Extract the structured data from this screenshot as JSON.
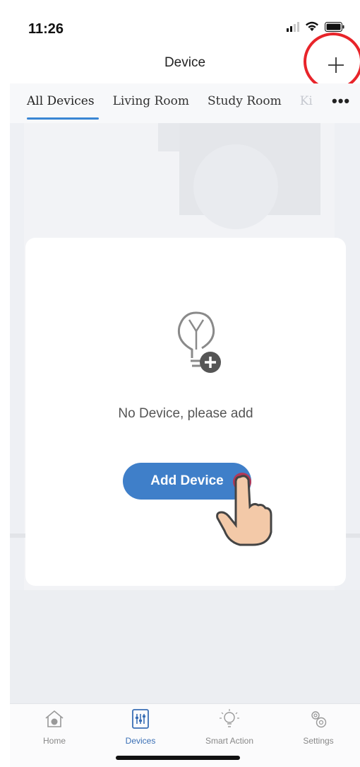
{
  "status_bar": {
    "time": "11:26"
  },
  "nav": {
    "title": "Device",
    "add_icon": "plus-icon"
  },
  "tabs": [
    {
      "label": "All Devices",
      "active": true
    },
    {
      "label": "Living Room",
      "active": false
    },
    {
      "label": "Study Room",
      "active": false
    },
    {
      "label": "Ki",
      "active": false
    }
  ],
  "more_label": "•••",
  "empty_state": {
    "icon": "lightbulb-add-icon",
    "message": "No Device, please add",
    "button_label": "Add Device"
  },
  "bottom_nav": [
    {
      "label": "Home",
      "icon": "home-icon"
    },
    {
      "label": "Devices",
      "icon": "devices-icon",
      "active": true
    },
    {
      "label": "Smart Action",
      "icon": "smart-action-icon"
    },
    {
      "label": "Settings",
      "icon": "gear-icon"
    }
  ],
  "colors": {
    "accent": "#3f7fc9",
    "highlight_ring": "#e8242a",
    "tab_underline": "#3a86d4"
  }
}
